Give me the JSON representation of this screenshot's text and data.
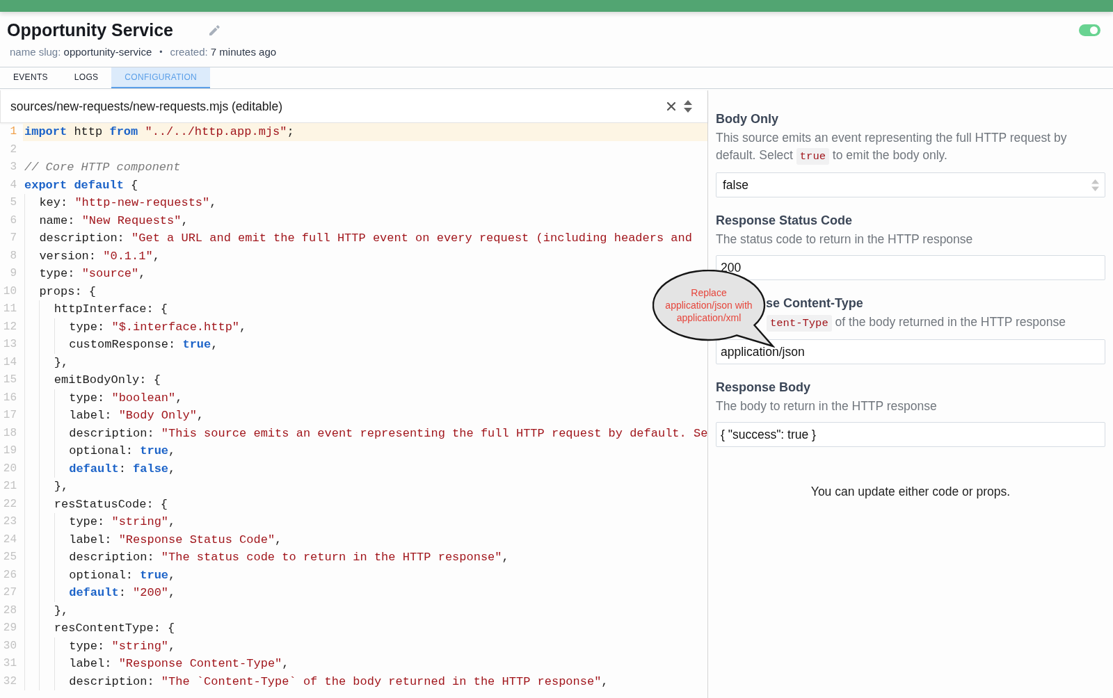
{
  "header": {
    "title": "Opportunity Service",
    "meta": [
      {
        "label": "name slug:",
        "value": "opportunity-service"
      },
      {
        "label": "created:",
        "value": "7 minutes ago"
      }
    ],
    "separator": "•",
    "toggle": {
      "on": true
    }
  },
  "tabs": [
    {
      "label": "EVENTS",
      "selected": false
    },
    {
      "label": "LOGS",
      "selected": false
    },
    {
      "label": "CONFIGURATION",
      "selected": true
    }
  ],
  "editor": {
    "file": "sources/new-requests/new-requests.mjs (editable)",
    "lines": [
      {
        "number": "1",
        "active": true,
        "tokens": [
          {
            "kind": "keyword",
            "text": "import"
          },
          {
            "kind": "plain",
            "text": " http "
          },
          {
            "kind": "keyword",
            "text": "from "
          },
          {
            "kind": "string",
            "text": "\"../../http.app.mjs\""
          },
          {
            "kind": "plain",
            "text": ";"
          }
        ]
      },
      {
        "number": "2",
        "active": false
      },
      {
        "number": "3",
        "active": false,
        "tokens": [
          {
            "kind": "comment",
            "text": "// Core HTTP component"
          }
        ]
      },
      {
        "number": "4",
        "active": false,
        "tokens": [
          {
            "kind": "keyword",
            "text": "export "
          },
          {
            "kind": "keyword",
            "text": "default"
          },
          {
            "kind": "plain",
            "text": " {"
          }
        ]
      },
      {
        "number": "5",
        "active": false,
        "tokens": [
          {
            "kind": "plain",
            "text": "  key: "
          },
          {
            "kind": "string",
            "text": "\"http-new-requests\""
          },
          {
            "kind": "plain",
            "text": ","
          }
        ]
      },
      {
        "number": "6",
        "active": false,
        "tokens": [
          {
            "kind": "plain",
            "text": "  name: "
          },
          {
            "kind": "string",
            "text": "\"New Requests\""
          },
          {
            "kind": "plain",
            "text": ","
          }
        ]
      },
      {
        "number": "7",
        "active": false,
        "tokens": [
          {
            "kind": "plain",
            "text": "  description: "
          },
          {
            "kind": "string",
            "text": "\"Get a URL and emit the full HTTP event on every request (including headers and"
          }
        ]
      },
      {
        "number": "8",
        "active": false,
        "tokens": [
          {
            "kind": "plain",
            "text": "  version: "
          },
          {
            "kind": "string",
            "text": "\"0.1.1\""
          },
          {
            "kind": "plain",
            "text": ","
          }
        ]
      },
      {
        "number": "9",
        "active": false,
        "tokens": [
          {
            "kind": "plain",
            "text": "  type: "
          },
          {
            "kind": "string",
            "text": "\"source\""
          },
          {
            "kind": "plain",
            "text": ","
          }
        ]
      },
      {
        "number": "10",
        "active": false,
        "tokens": [
          {
            "kind": "plain",
            "text": "  props: {"
          }
        ]
      },
      {
        "number": "11",
        "active": false,
        "tokens": [
          {
            "kind": "plain",
            "text": "    httpInterface: {"
          }
        ]
      },
      {
        "number": "12",
        "active": false,
        "tokens": [
          {
            "kind": "plain",
            "text": "      type: "
          },
          {
            "kind": "string",
            "text": "\"$.interface.http\""
          },
          {
            "kind": "plain",
            "text": ","
          }
        ]
      },
      {
        "number": "13",
        "active": false,
        "tokens": [
          {
            "kind": "plain",
            "text": "      customResponse: "
          },
          {
            "kind": "keyword",
            "text": "true"
          },
          {
            "kind": "plain",
            "text": ","
          }
        ]
      },
      {
        "number": "14",
        "active": false,
        "tokens": [
          {
            "kind": "plain",
            "text": "    },"
          }
        ]
      },
      {
        "number": "15",
        "active": false,
        "tokens": [
          {
            "kind": "plain",
            "text": "    emitBodyOnly: {"
          }
        ]
      },
      {
        "number": "16",
        "active": false,
        "tokens": [
          {
            "kind": "plain",
            "text": "      type: "
          },
          {
            "kind": "string",
            "text": "\"boolean\""
          },
          {
            "kind": "plain",
            "text": ","
          }
        ]
      },
      {
        "number": "17",
        "active": false,
        "tokens": [
          {
            "kind": "plain",
            "text": "      label: "
          },
          {
            "kind": "string",
            "text": "\"Body Only\""
          },
          {
            "kind": "plain",
            "text": ","
          }
        ]
      },
      {
        "number": "18",
        "active": false,
        "tokens": [
          {
            "kind": "plain",
            "text": "      description: "
          },
          {
            "kind": "string",
            "text": "\"This source emits an event representing the full HTTP request by default. Se"
          }
        ]
      },
      {
        "number": "19",
        "active": false,
        "tokens": [
          {
            "kind": "plain",
            "text": "      optional: "
          },
          {
            "kind": "keyword",
            "text": "true"
          },
          {
            "kind": "plain",
            "text": ","
          }
        ]
      },
      {
        "number": "20",
        "active": false,
        "tokens": [
          {
            "kind": "keyword",
            "text": "      default"
          },
          {
            "kind": "plain",
            "text": ": "
          },
          {
            "kind": "keyword",
            "text": "false"
          },
          {
            "kind": "plain",
            "text": ","
          }
        ]
      },
      {
        "number": "21",
        "active": false,
        "tokens": [
          {
            "kind": "plain",
            "text": "    },"
          }
        ]
      },
      {
        "number": "22",
        "active": false,
        "tokens": [
          {
            "kind": "plain",
            "text": "    resStatusCode: {"
          }
        ]
      },
      {
        "number": "23",
        "active": false,
        "tokens": [
          {
            "kind": "plain",
            "text": "      type: "
          },
          {
            "kind": "string",
            "text": "\"string\""
          },
          {
            "kind": "plain",
            "text": ","
          }
        ]
      },
      {
        "number": "24",
        "active": false,
        "tokens": [
          {
            "kind": "plain",
            "text": "      label: "
          },
          {
            "kind": "string",
            "text": "\"Response Status Code\""
          },
          {
            "kind": "plain",
            "text": ","
          }
        ]
      },
      {
        "number": "25",
        "active": false,
        "tokens": [
          {
            "kind": "plain",
            "text": "      description: "
          },
          {
            "kind": "string",
            "text": "\"The status code to return in the HTTP response\""
          },
          {
            "kind": "plain",
            "text": ","
          }
        ]
      },
      {
        "number": "26",
        "active": false,
        "tokens": [
          {
            "kind": "plain",
            "text": "      optional: "
          },
          {
            "kind": "keyword",
            "text": "true"
          },
          {
            "kind": "plain",
            "text": ","
          }
        ]
      },
      {
        "number": "27",
        "active": false,
        "tokens": [
          {
            "kind": "keyword",
            "text": "      default"
          },
          {
            "kind": "plain",
            "text": ": "
          },
          {
            "kind": "string",
            "text": "\"200\""
          },
          {
            "kind": "plain",
            "text": ","
          }
        ]
      },
      {
        "number": "28",
        "active": false,
        "tokens": [
          {
            "kind": "plain",
            "text": "    },"
          }
        ]
      },
      {
        "number": "29",
        "active": false,
        "tokens": [
          {
            "kind": "plain",
            "text": "    resContentType: {"
          }
        ]
      },
      {
        "number": "30",
        "active": false,
        "tokens": [
          {
            "kind": "plain",
            "text": "      type: "
          },
          {
            "kind": "string",
            "text": "\"string\""
          },
          {
            "kind": "plain",
            "text": ","
          }
        ]
      },
      {
        "number": "31",
        "active": false,
        "tokens": [
          {
            "kind": "plain",
            "text": "      label: "
          },
          {
            "kind": "string",
            "text": "\"Response Content-Type\""
          },
          {
            "kind": "plain",
            "text": ","
          }
        ]
      },
      {
        "number": "32",
        "active": false,
        "tokens": [
          {
            "kind": "plain",
            "text": "      description: "
          },
          {
            "kind": "string",
            "text": "\"The `Content-Type` of the body returned in the HTTP response\""
          },
          {
            "kind": "plain",
            "text": ","
          }
        ]
      }
    ]
  },
  "props_form": {
    "fields": [
      {
        "kind": "select",
        "label": "Body Only",
        "description": [
          {
            "kind": "text",
            "text": "This source emits an event representing the full HTTP request by default. Select "
          },
          {
            "kind": "code",
            "text": "true"
          },
          {
            "kind": "text",
            "text": " to emit the body only."
          }
        ],
        "value": "false"
      },
      {
        "kind": "input",
        "label": "Response Status Code",
        "description": [
          {
            "kind": "text",
            "text": "The status code to return in the HTTP response"
          }
        ],
        "value": "200"
      },
      {
        "kind": "input",
        "label": "se Content-Type",
        "description": [
          {
            "kind": "code",
            "text": "tent-Type"
          },
          {
            "kind": "text",
            "text": " of the body returned in the HTTP response"
          }
        ],
        "value": "application/json",
        "callout": {
          "text": "Replace application/json with application/xml"
        }
      },
      {
        "kind": "input",
        "label": "Response Body",
        "description": [
          {
            "kind": "text",
            "text": "The body to return in the HTTP response"
          }
        ],
        "value": "{ \"success\": true }"
      }
    ],
    "note": "You can update either code or props."
  }
}
